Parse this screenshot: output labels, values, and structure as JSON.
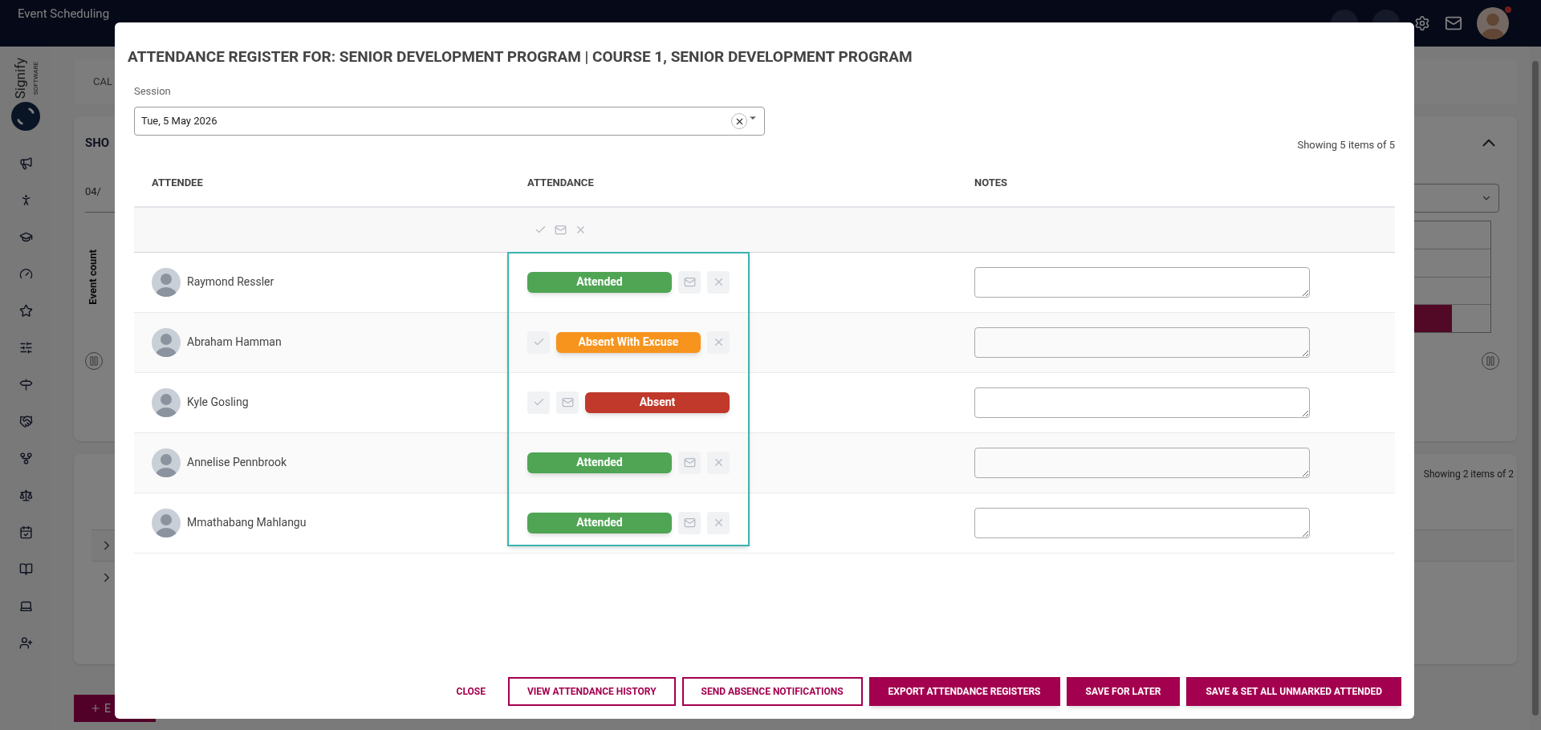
{
  "app": {
    "title": "Event Scheduling"
  },
  "logo": {
    "name": "Signify",
    "tagline": "SOFTWARE"
  },
  "background": {
    "tab": "CAL",
    "card_title": "SHO",
    "date_field": "04/",
    "axis_label": "Event count",
    "count": "Showing 2 items of 2",
    "add_button": "E"
  },
  "modal": {
    "title": "ATTENDANCE REGISTER FOR: SENIOR DEVELOPMENT PROGRAM | COURSE 1, SENIOR DEVELOPMENT PROGRAM",
    "session": {
      "label": "Session",
      "value": "Tue, 5 May 2026"
    },
    "count": "Showing 5 items of 5",
    "columns": [
      "ATTENDEE",
      "ATTENDANCE",
      "NOTES"
    ],
    "attendees": [
      {
        "name": "Raymond Ressler",
        "kind": "attended",
        "status_label": "Attended"
      },
      {
        "name": "Abraham Hamman",
        "kind": "excused",
        "status_label": "Absent With Excuse"
      },
      {
        "name": "Kyle Gosling",
        "kind": "absent",
        "status_label": "Absent"
      },
      {
        "name": "Annelise Pennbrook",
        "kind": "attended",
        "status_label": "Attended"
      },
      {
        "name": "Mmathabang Mahlangu",
        "kind": "attended",
        "status_label": "Attended"
      }
    ],
    "buttons": [
      {
        "label": "CLOSE",
        "kind": "text"
      },
      {
        "label": "VIEW ATTENDANCE HISTORY",
        "kind": "outline"
      },
      {
        "label": "SEND ABSENCE NOTIFICATIONS",
        "kind": "outline"
      },
      {
        "label": "EXPORT ATTENDANCE REGISTERS",
        "kind": "filled"
      },
      {
        "label": "SAVE FOR LATER",
        "kind": "filled"
      },
      {
        "label": "SAVE & SET ALL UNMARKED ATTENDED",
        "kind": "filled"
      }
    ]
  }
}
